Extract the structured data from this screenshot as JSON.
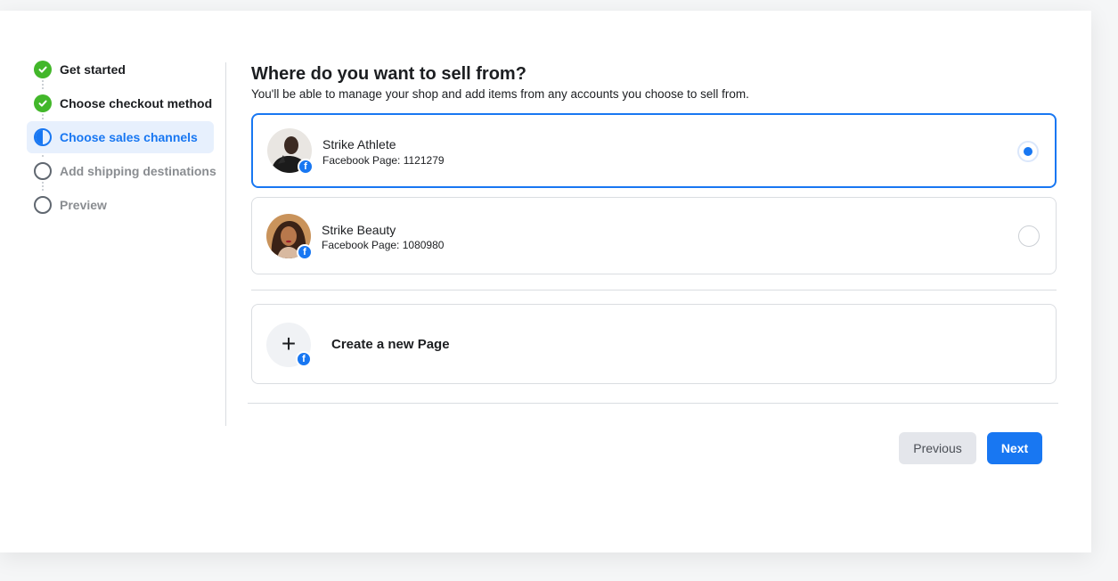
{
  "steps": [
    {
      "label": "Get started",
      "state": "done"
    },
    {
      "label": "Choose checkout method",
      "state": "done"
    },
    {
      "label": "Choose sales channels",
      "state": "active"
    },
    {
      "label": "Add shipping destinations",
      "state": "todo"
    },
    {
      "label": "Preview",
      "state": "todo"
    }
  ],
  "main": {
    "title": "Where do you want to sell from?",
    "subtitle": "You'll be able to manage your shop and add items from any accounts you choose to sell from."
  },
  "pages": [
    {
      "name": "Strike Athlete",
      "detail": "Facebook Page: 1121279",
      "selected": true
    },
    {
      "name": "Strike Beauty",
      "detail": "Facebook Page: 1080980",
      "selected": false
    }
  ],
  "create_page": {
    "label": "Create a new Page"
  },
  "badge_glyph": "f",
  "plus_glyph": "+",
  "buttons": {
    "previous": "Previous",
    "next": "Next"
  },
  "colors": {
    "accent": "#1877f2",
    "success": "#42b72a",
    "active_bg": "#e7f0fd"
  },
  "icons": {
    "done": "check-circle-icon",
    "active": "half-circle-icon",
    "todo": "empty-circle-icon",
    "badge": "facebook-icon",
    "create": "plus-icon"
  }
}
